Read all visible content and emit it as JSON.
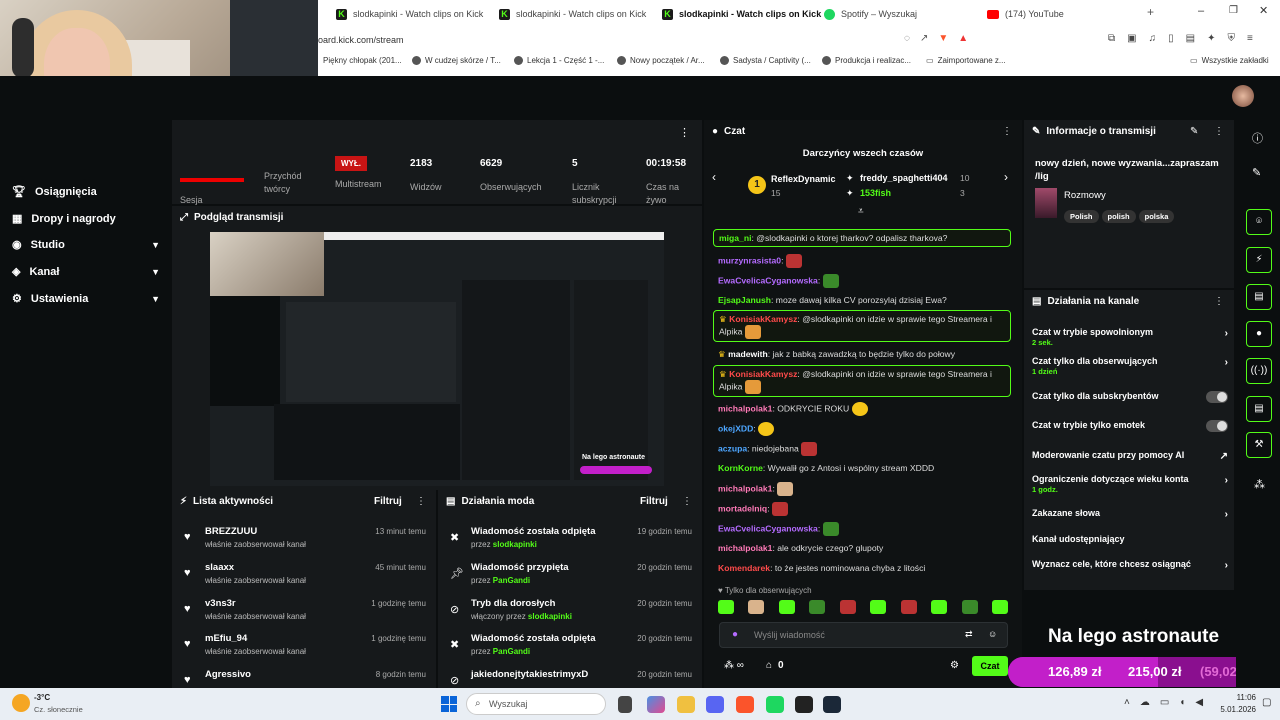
{
  "browser": {
    "tabs": [
      {
        "label": "slodkapinki - Watch clips on Kick",
        "icon": "kick-favicon"
      },
      {
        "label": "slodkapinki - Watch clips on Kick",
        "icon": "kick-favicon"
      },
      {
        "label": "slodkapinki - Watch clips on Kick",
        "icon": "kick-favicon"
      },
      {
        "label": "Spotify – Wyszukaj",
        "icon": "spotify-favicon"
      },
      {
        "label": "(174) YouTube",
        "icon": "youtube-favicon"
      }
    ],
    "url": "oard.kick.com/stream",
    "bookmarks": [
      "Piękny chłopak (201...",
      "W cudzej skórze / T...",
      "Lekcja 1 - Część 1 -...",
      "Nowy początek / Ar...",
      "Sadysta / Captivity (...",
      "Produkcja i realizac...",
      "Zaimportowane z...",
      "Wszystkie zakładki"
    ]
  },
  "sidebar": {
    "items": [
      {
        "label": "Osiągnięcia",
        "icon": "trophy-icon"
      },
      {
        "label": "Dropy i nagrody",
        "icon": "gift-icon"
      },
      {
        "label": "Studio",
        "icon": "studio-icon"
      },
      {
        "label": "Kanał",
        "icon": "channel-icon"
      },
      {
        "label": "Ustawienia",
        "icon": "gear-icon"
      }
    ]
  },
  "stats": {
    "live_badge": "WYŁ.",
    "items": [
      {
        "value": "",
        "label": "Sesja"
      },
      {
        "value": "",
        "label": "Przychód twórcy"
      },
      {
        "value": "",
        "label": "Multistream"
      },
      {
        "value": "2183",
        "label": "Widzów"
      },
      {
        "value": "6629",
        "label": "Obserwujących"
      },
      {
        "value": "5",
        "label": "Licznik subskrypcji"
      },
      {
        "value": "00:19:58",
        "label": "Czas na żywo"
      }
    ]
  },
  "preview": {
    "title": "Podgląd transmisji"
  },
  "activity": {
    "title": "Lista aktywności",
    "filter": "Filtruj",
    "items": [
      {
        "name": "BREZZUUU",
        "action": "właśnie zaobserwował kanał",
        "time": "13 minut temu"
      },
      {
        "name": "slaaxx",
        "action": "właśnie zaobserwował kanał",
        "time": "45 minut temu"
      },
      {
        "name": "v3ns3r",
        "action": "właśnie zaobserwował kanał",
        "time": "1 godzinę temu"
      },
      {
        "name": "mEfiu_94",
        "action": "właśnie zaobserwował kanał",
        "time": "1 godzinę temu"
      },
      {
        "name": "Agressivo",
        "action": "",
        "time": "8 godzin temu"
      }
    ]
  },
  "mod_actions": {
    "title": "Działania moda",
    "filter": "Filtruj",
    "items": [
      {
        "title": "Wiadomość została odpięta",
        "by_prefix": "przez",
        "by": "slodkapinki",
        "time": "19 godzin temu",
        "icon": "pin-off-icon"
      },
      {
        "title": "Wiadomość przypięta",
        "by_prefix": "przez",
        "by": "PanGandi",
        "time": "20 godzin temu",
        "icon": "pin-icon"
      },
      {
        "title": "Tryb dla dorosłych",
        "by_prefix": "włączony przez",
        "by": "slodkapinki",
        "time": "20 godzin temu",
        "icon": "eye-off-icon"
      },
      {
        "title": "Wiadomość została odpięta",
        "by_prefix": "przez",
        "by": "PanGandi",
        "time": "20 godzin temu",
        "icon": "pin-off-icon"
      },
      {
        "title": "jakiedonejtytakiestrimyxD",
        "by_prefix": "",
        "by": "",
        "time": "20 godzin temu",
        "icon": "ban-icon"
      }
    ]
  },
  "chat": {
    "title": "Czat",
    "leaders_title": "Darczyńcy wszech czasów",
    "leaders": [
      {
        "rank": "1",
        "name": "ReflexDynamic",
        "amount": "15"
      },
      {
        "rank": "",
        "name": "freddy_spaghetti404",
        "amount": "10"
      },
      {
        "rank": "",
        "name": "153fish",
        "amount": "3"
      }
    ],
    "messages": [
      {
        "user": "miga_ni",
        "text": ": @slodkapinki o ktorej tharkov? odpalisz tharkova?",
        "color": "#53fc18",
        "highlight": true
      },
      {
        "user": "murzynrasista0",
        "text": ":",
        "color": "#b46bff",
        "highlight": false
      },
      {
        "user": "EwaCvelicaCyganowska",
        "text": ":",
        "color": "#b46bff",
        "highlight": false
      },
      {
        "user": "EjsapJanush",
        "text": ": moze dawaj kilka CV porozsylaj dzisiaj Ewa?",
        "color": "#53fc18",
        "highlight": false
      },
      {
        "user": "KonisiakKamysz",
        "text": ": @slodkapinki on idzie w sprawie tego Streamera i Alpika",
        "color": "#ff4b4b",
        "highlight": true
      },
      {
        "user": "madewith",
        "text": ": jak z babką zawadzką to będzie tylko do połowy",
        "color": "#ffffff",
        "highlight": false
      },
      {
        "user": "KonisiakKamysz",
        "text": ": @slodkapinki on idzie w sprawie tego Streamera i Alpika",
        "color": "#ff4b4b",
        "highlight": true
      },
      {
        "user": "michalpolak1",
        "text": ": ODKRYCIE ROKU",
        "color": "#ff7ab8",
        "highlight": false
      },
      {
        "user": "okejXDD",
        "text": ":",
        "color": "#4da6ff",
        "highlight": false
      },
      {
        "user": "aczupa",
        "text": ": niedojebana",
        "color": "#4da6ff",
        "highlight": false
      },
      {
        "user": "KornKorne",
        "text": ": Wywalił go z Antosi i wspólny stream XDDD",
        "color": "#53fc18",
        "highlight": false
      },
      {
        "user": "michalpolak1",
        "text": ":",
        "color": "#ff7ab8",
        "highlight": false
      },
      {
        "user": "mortadelniq",
        "text": ":",
        "color": "#ff7ab8",
        "highlight": false
      },
      {
        "user": "EwaCvelicaCyganowska",
        "text": ":",
        "color": "#b46bff",
        "highlight": false
      },
      {
        "user": "michalpolak1",
        "text": ": ale odkrycie czego? glupoty",
        "color": "#ff7ab8",
        "highlight": false
      },
      {
        "user": "Komendarek",
        "text": ": to że jestes nominowana chyba z litości",
        "color": "#ff4b4b",
        "highlight": false
      }
    ],
    "followers_only": "Tylko dla obserwujących",
    "input_placeholder": "Wyślij wiadomość",
    "points": "0",
    "send": "Czat"
  },
  "stream_info": {
    "title": "Informacje o transmisji",
    "stream_title": "nowy dzień, nowe wyzwania...zapraszam /lig",
    "category": "Rozmowy",
    "tags": [
      "Polish",
      "polish",
      "polska"
    ]
  },
  "channel_actions": {
    "title": "Działania na kanale",
    "items": [
      {
        "label": "Czat w trybie spowolnionym",
        "sub": "2 sek.",
        "control": "chevron"
      },
      {
        "label": "Czat tylko dla obserwujących",
        "sub": "1 dzień",
        "control": "chevron"
      },
      {
        "label": "Czat tylko dla subskrybentów",
        "sub": "",
        "control": "toggle"
      },
      {
        "label": "Czat w trybie tylko emotek",
        "sub": "",
        "control": "toggle"
      },
      {
        "label": "Moderowanie czatu przy pomocy AI",
        "sub": "",
        "control": "external"
      },
      {
        "label": "Ograniczenie dotyczące wieku konta",
        "sub": "1 godz.",
        "control": "chevron"
      },
      {
        "label": "Zakazane słowa",
        "sub": "",
        "control": "chevron"
      },
      {
        "label": "Kanał udostępniający",
        "sub": "",
        "control": "none"
      },
      {
        "label": "Wyznacz cele, które chcesz osiągnąć",
        "sub": "",
        "control": "chevron"
      }
    ]
  },
  "goal_overlay": {
    "title": "Na lego astronaute",
    "current": "126,89 zł",
    "target": "215,00 zł",
    "percent": "(59,02%)",
    "fraction": 0.5902
  },
  "taskbar": {
    "weather_temp": "-3°C",
    "weather_desc": "Cz. słonecznie",
    "search_placeholder": "Wyszukaj",
    "time": "11:06",
    "date": "5.01.2026"
  },
  "colors": {
    "accent": "#53fc18",
    "panel": "#16191b",
    "bg": "#0b0e0f",
    "goal": "#c21fc9"
  }
}
